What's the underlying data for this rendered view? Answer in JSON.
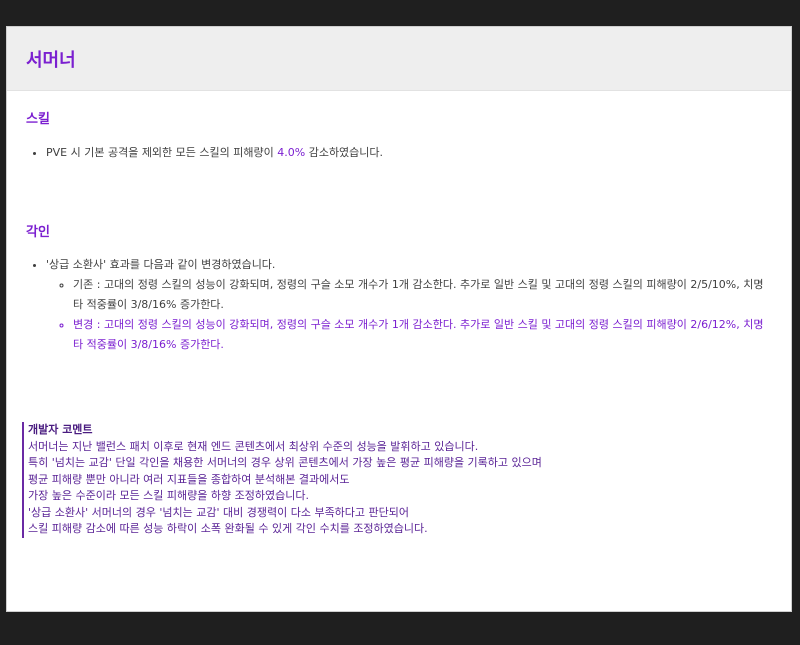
{
  "page_title": "서머너",
  "skill_section": {
    "heading": "스킬",
    "items": [
      {
        "before": "PVE 시 기본 공격을 제외한 모든 스킬의 피해량이 ",
        "highlight": "4.0%",
        "after": " 감소하였습니다."
      }
    ]
  },
  "engrave_section": {
    "heading": "각인",
    "intro": "'상급 소환사' 효과를 다음과 같이 변경하였습니다.",
    "before_item": "기존 : 고대의 정령 스킬의 성능이 강화되며, 정령의 구슬 소모 개수가 1개 감소한다. 추가로 일반 스킬 및 고대의 정령 스킬의 피해량이 2/5/10%, 치명타 적중률이 3/8/16% 증가한다.",
    "after_item": "변경 : 고대의 정령 스킬의 성능이 강화되며, 정령의 구슬 소모 개수가 1개 감소한다. 추가로 일반 스킬 및 고대의 정령 스킬의 피해량이 2/6/12%, 치명타 적중률이 3/8/16% 증가한다."
  },
  "dev_comment": {
    "title": "개발자 코멘트",
    "lines": [
      "서머너는 지난 밸런스 패치 이후로 현재 엔드 콘텐츠에서 최상위 수준의 성능을 발휘하고 있습니다.",
      "특히 '넘치는 교감' 단일 각인을 채용한 서머너의 경우 상위 콘텐츠에서 가장 높은 평균 피해량을 기록하고 있으며",
      "평균 피해량 뿐만 아니라 여러 지표들을 종합하여 분석해본 결과에서도",
      "가장 높은 수준이라 모든 스킬 피해량을 하향 조정하였습니다.",
      "'상급 소환사' 서머너의 경우 '넘치는 교감' 대비 경쟁력이 다소 부족하다고 판단되어",
      "스킬 피해량 감소에 따른 성능 하락이 소폭 완화될 수 있게 각인 수치를 조정하였습니다."
    ]
  },
  "colors": {
    "accent": "#7b1fd0",
    "comment_text": "#5a2396",
    "body_text": "#3f3f3f",
    "header_bg": "#eeeeee"
  }
}
